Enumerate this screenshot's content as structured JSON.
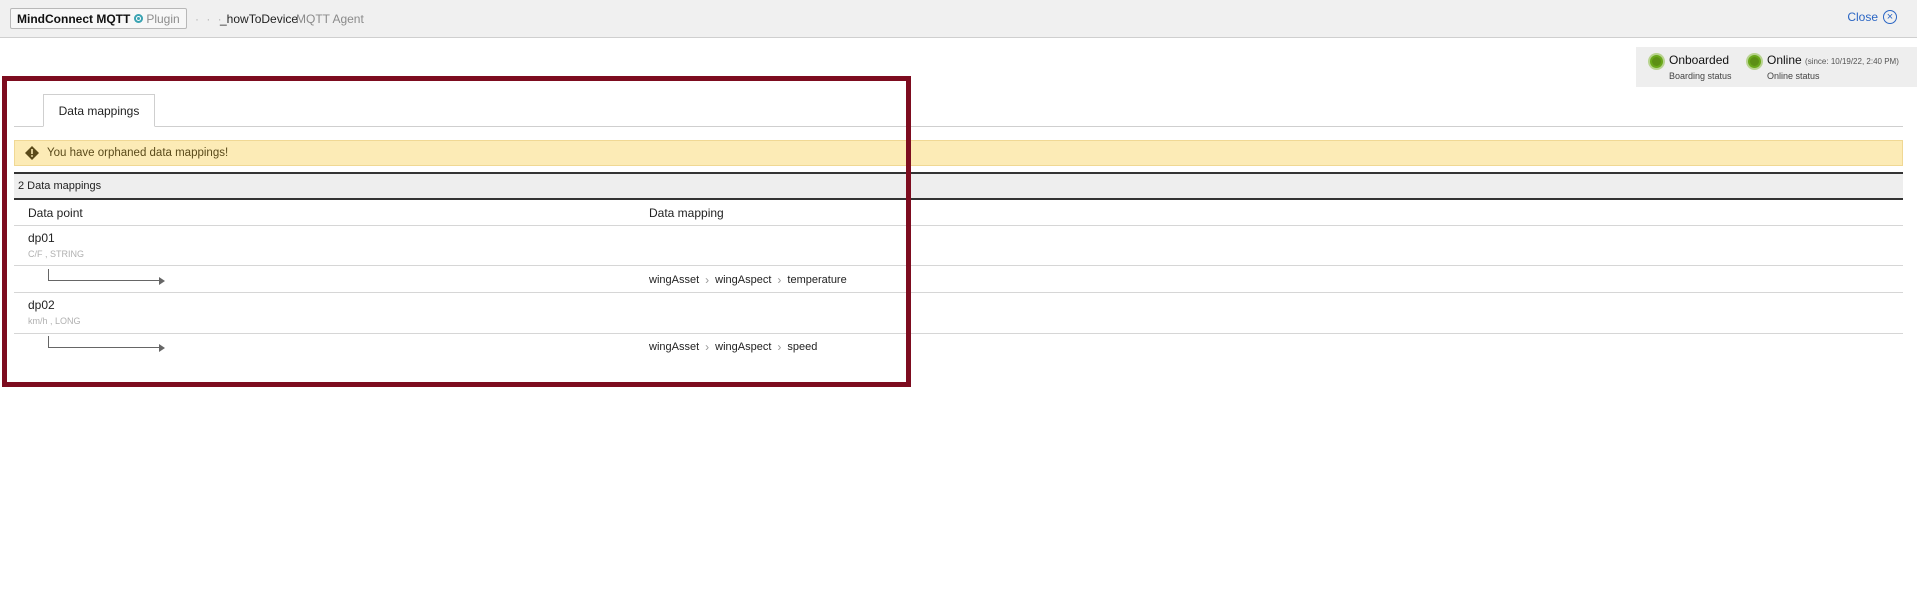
{
  "header": {
    "plugin_name": "MindConnect MQTT",
    "plugin_tag": "Plugin",
    "breadcrumb_dots": "· · ·",
    "device_name": "_howToDevice",
    "agent_type": "MQTT Agent",
    "close_label": "Close"
  },
  "status": {
    "boarding": {
      "label": "Onboarded",
      "sub": "Boarding status"
    },
    "online": {
      "label": "Online",
      "since": "(since: 10/19/22, 2:40 PM)",
      "sub": "Online status"
    }
  },
  "tabs": [
    {
      "label": "Data mappings"
    }
  ],
  "warning": {
    "text": "You have orphaned data mappings!"
  },
  "table": {
    "count_label": "2 Data mappings",
    "headers": [
      "Data point",
      "Data mapping"
    ],
    "rows": [
      {
        "name": "dp01",
        "type": "C/F , STRING",
        "mapping": [
          "wingAsset",
          "wingAspect",
          "temperature"
        ]
      },
      {
        "name": "dp02",
        "type": "km/h , LONG",
        "mapping": [
          "wingAsset",
          "wingAspect",
          "speed"
        ]
      }
    ]
  },
  "colors": {
    "highlight_frame": "#7d0c1f",
    "status_green": "#5c8f14",
    "warning_bg": "#fcebb6",
    "link_blue": "#2b66c4"
  }
}
